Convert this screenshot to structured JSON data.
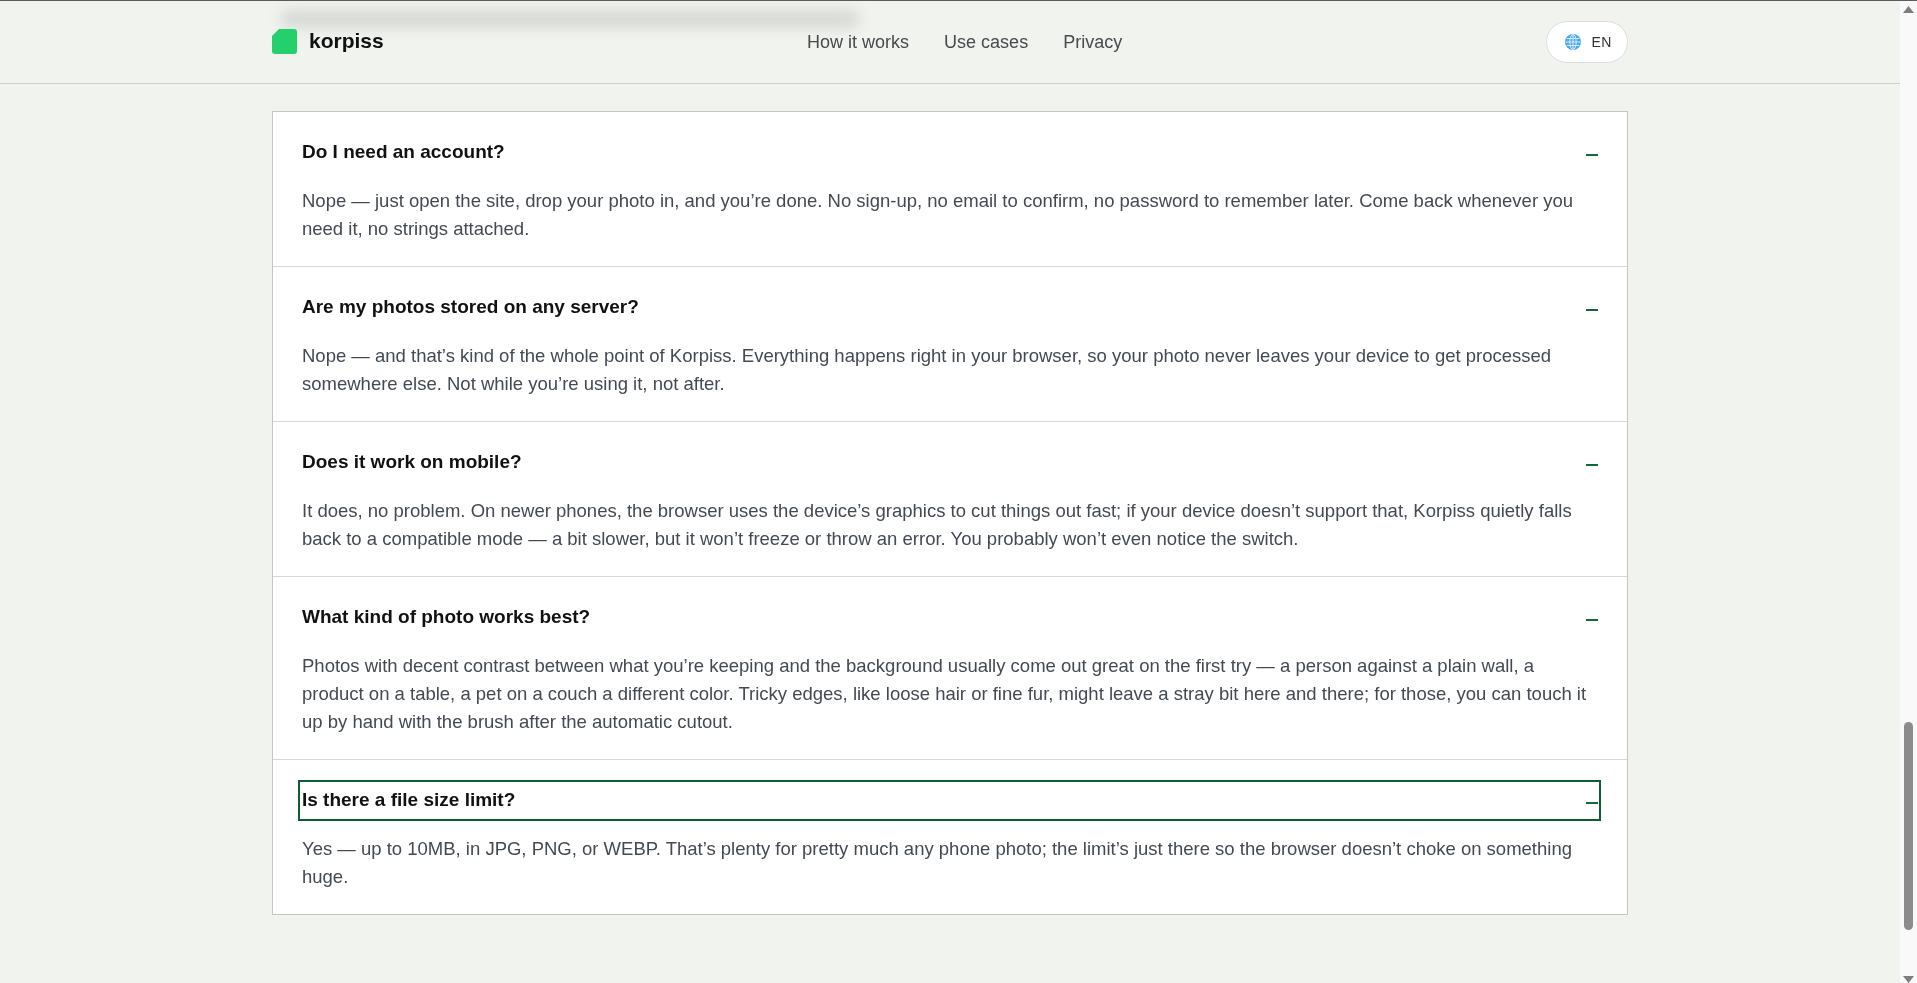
{
  "header": {
    "logo": {
      "text": "korpiss"
    },
    "nav": [
      {
        "label": "How it works"
      },
      {
        "label": "Use cases"
      },
      {
        "label": "Privacy"
      }
    ],
    "language_button": {
      "label": "EN"
    }
  },
  "faq": [
    {
      "question": "Do I need an account?",
      "answer": "Nope — just open the site, drop your photo in, and you’re done. No sign-up, no email to confirm, no password to remember later. Come back whenever you need it, no strings attached.",
      "expanded": true,
      "focused": false
    },
    {
      "question": "Are my photos stored on any server?",
      "answer": "Nope — and that’s kind of the whole point of Korpiss. Everything happens right in your browser, so your photo never leaves your device to get processed somewhere else. Not while you’re using it, not after.",
      "expanded": true,
      "focused": false
    },
    {
      "question": "Does it work on mobile?",
      "answer": "It does, no problem. On newer phones, the browser uses the device’s graphics to cut things out fast; if your device doesn’t support that, Korpiss quietly falls back to a compatible mode — a bit slower, but it won’t freeze or throw an error. You probably won’t even notice the switch.",
      "expanded": true,
      "focused": false
    },
    {
      "question": "What kind of photo works best?",
      "answer": "Photos with decent contrast between what you’re keeping and the background usually come out great on the first try — a person against a plain wall, a product on a table, a pet on a couch a different color. Tricky edges, like loose hair or fine fur, might leave a stray bit here and there; for those, you can touch it up by hand with the brush after the automatic cutout.",
      "expanded": true,
      "focused": false
    },
    {
      "question": "Is there a file size limit?",
      "answer": "Yes — up to 10MB, in JPG, PNG, or WEBP. That’s plenty for pretty much any phone photo; the limit’s just there so the browser doesn’t choke on something huge.",
      "expanded": true,
      "focused": true
    }
  ]
}
